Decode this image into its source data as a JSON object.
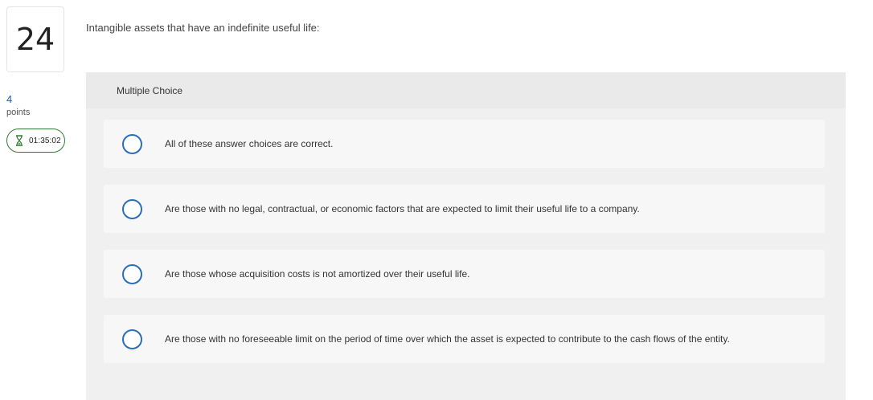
{
  "question_number": "24",
  "points": {
    "value": "4",
    "label": "points"
  },
  "timer": {
    "icon": "hourglass-icon",
    "text": "01:35:02",
    "color": "#2e7d32"
  },
  "question_text": "Intangible assets that have an indefinite useful life:",
  "multiple_choice": {
    "header": "Multiple Choice",
    "accent_color": "#2a6ebb",
    "choices": [
      {
        "label": "All of these answer choices are correct.",
        "selected": false
      },
      {
        "label": "Are those with no legal, contractual, or economic factors that are expected to limit their useful life to a company.",
        "selected": false
      },
      {
        "label": "Are those whose acquisition costs is not amortized over their useful life.",
        "selected": false
      },
      {
        "label": "Are those with no foreseeable limit on the period of time over which the asset is expected to contribute to the cash flows of the entity.",
        "selected": false
      }
    ]
  }
}
